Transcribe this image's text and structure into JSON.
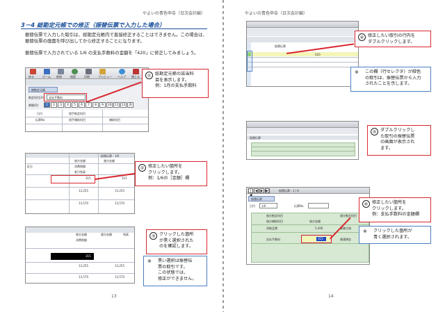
{
  "left_page": {
    "header": "やよいの青色申告（日次会計編）",
    "section_title": "3－4 総勘定元帳での修正（振替伝票で入力した場合）",
    "paragraph1": "振替伝票で入力した取引は、総勘定元帳内で直接修正することはできません。この場合は、振替伝票の画面を呼び出してから修正することになります。",
    "paragraph2": "振替伝票で入力されている 1/6 の支払手数料の金額を「420」に修正してみましょう。",
    "page_number": "13",
    "screenshot1": {
      "toolbar_icons": [
        "戻る",
        "ホーム",
        "削除",
        "検索",
        "印刷",
        "プレビュー",
        "ヘルプ",
        "閉じる"
      ],
      "tab_label": "総勘定元帳",
      "account_label": "勘定科目(A)",
      "account_value": "支払手数料",
      "period_label": "期間(D)",
      "months": [
        "1",
        "2",
        "3",
        "4",
        "5",
        "6",
        "7",
        "8",
        "9",
        "10",
        "11",
        "12",
        "決"
      ],
      "col_date": "日付",
      "col_slip": "伝票No",
      "col_counter": "相手勘定科目",
      "col_counter_sub": "相手補助科目",
      "col_sub": "補助科目"
    },
    "screenshot2": {
      "label_slip": "振替伝票 - 1/6",
      "col1": "借方金額",
      "col2": "貸方金額",
      "row_tax": "消費税額",
      "row_balance": "差引残高",
      "label_section": "区分",
      "amount_selected": "315",
      "amount_a": "315",
      "amount_b": "13,255",
      "amount_c": "13,255",
      "amount_d": "13,570",
      "amount_e": "13,570"
    },
    "screenshot3": {
      "col1": "借方金額",
      "col2": "貸方金額",
      "col3": "残高",
      "row_tax": "消費税額",
      "amount_selected": "315",
      "amount_b": "13,255",
      "amount_c": "13,255",
      "amount_d": "13,570",
      "amount_e": "13,570"
    },
    "callout1": {
      "num": "①",
      "lines": [
        "総勘定元帳の該当科",
        "目を表示します。",
        "例：1月の支払手数料"
      ]
    },
    "callout2": {
      "num": "②",
      "lines": [
        "修正したい箇所を",
        "クリックします。",
        "例：1/6の［金額］欄"
      ]
    },
    "callout3": {
      "num": "③",
      "lines": [
        "クリックした箇所",
        "が黒く選択された",
        "のを確認します。"
      ]
    },
    "note1": {
      "mark": "※",
      "lines": [
        "黒い選択は振替伝",
        "票の取引です。",
        "この状態では、",
        "修正ができません。"
      ]
    }
  },
  "right_page": {
    "header": "やよいの青色申告（日次会計編）",
    "page_number": "14",
    "screenshot_top": {
      "amount_a": "420",
      "label_1": "振替伝票"
    },
    "screenshot_mid": {
      "label_1": "振替伝票"
    },
    "screenshot_bottom": {
      "tab_label": "振替伝票",
      "bar_title": "振替伝票 - 1 / 6",
      "date_label": "日付",
      "date_value": "1/6",
      "slip_label": "伝票No.",
      "col1": "借方勘定科目",
      "col2": "借方補助科目",
      "col3": "借方金額",
      "col4": "貸方勘定科目",
      "row1_account": "消耗品費",
      "row1_amount": "5,400",
      "row1_credit": "事業主借",
      "row2_account": "支払手数料",
      "row2_amount": "315",
      "row2_credit": "普通預金"
    },
    "callout4": {
      "num": "④",
      "lines": [
        "修正したい取引の行内を",
        "ダブルクリックします。"
      ]
    },
    "note2": {
      "mark": "※",
      "lines": [
        "この欄（行セレクタ）が緑色",
        "の取引は、振替伝票から入力",
        "されたことを示します。"
      ]
    },
    "callout5": {
      "num": "⑤",
      "lines": [
        "ダブルクリックし",
        "た取引の振替伝票",
        "の画面が表示され",
        "ます。"
      ]
    },
    "callout6": {
      "num": "⑥",
      "lines": [
        "修正したい箇所を",
        "クリックします。",
        "例：支払手数料の金額欄"
      ]
    },
    "note3": {
      "mark": "※",
      "lines": [
        "クリックした箇所が",
        "青く選択されます。"
      ]
    }
  }
}
